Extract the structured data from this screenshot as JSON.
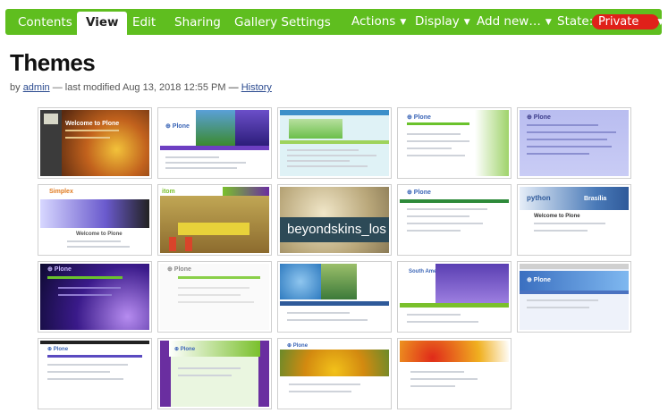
{
  "toolbar": {
    "tabs": [
      {
        "label": "Contents"
      },
      {
        "label": "View"
      },
      {
        "label": "Edit"
      },
      {
        "label": "Sharing"
      },
      {
        "label": "Gallery Settings"
      }
    ],
    "menus": [
      {
        "label": "Actions"
      },
      {
        "label": "Display"
      },
      {
        "label": "Add new…"
      }
    ],
    "state_label": "State:",
    "state_value": "Private",
    "colors": {
      "bar": "#5fbe1f",
      "state": "#e0201a"
    }
  },
  "page": {
    "title": "Themes",
    "byline": {
      "by": "by",
      "author": "admin",
      "modified": "— last modified Aug 13, 2018 12:55 PM",
      "dash": "—",
      "history": "History"
    }
  },
  "gallery": {
    "overlay_label": "beyondskins_los"
  }
}
